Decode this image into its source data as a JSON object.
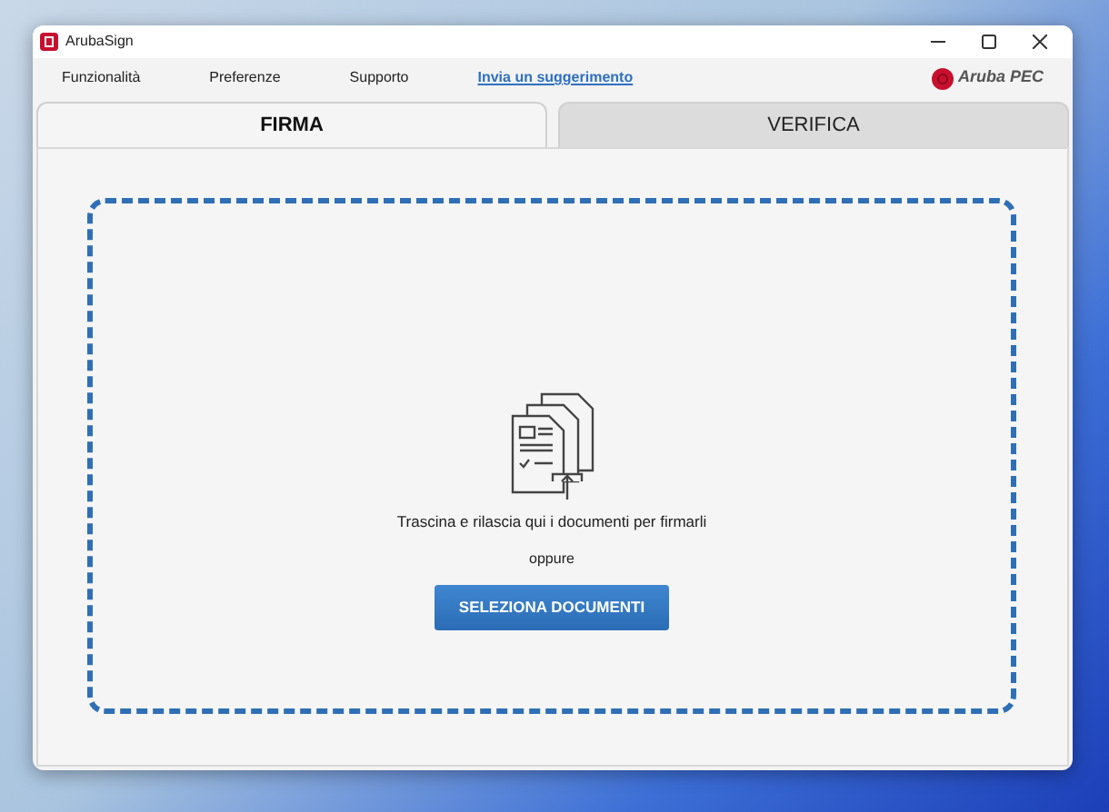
{
  "window": {
    "title": "ArubaSign"
  },
  "menu": [
    {
      "label": "Funzionalità",
      "kind": "menu"
    },
    {
      "label": "Preferenze",
      "kind": "menu"
    },
    {
      "label": "Supporto",
      "kind": "menu"
    },
    {
      "label": "Invia un suggerimento",
      "kind": "link"
    }
  ],
  "logo": {
    "text": "Aruba PEC"
  },
  "tabs": [
    {
      "label": "FIRMA",
      "selected": true
    },
    {
      "label": "VERIFICA",
      "selected": false
    }
  ],
  "drop_zone": {
    "instruction": "Trascina e rilascia qui i documenti per firmarli",
    "separator": "oppure",
    "button": "SELEZIONA DOCUMENTI"
  }
}
